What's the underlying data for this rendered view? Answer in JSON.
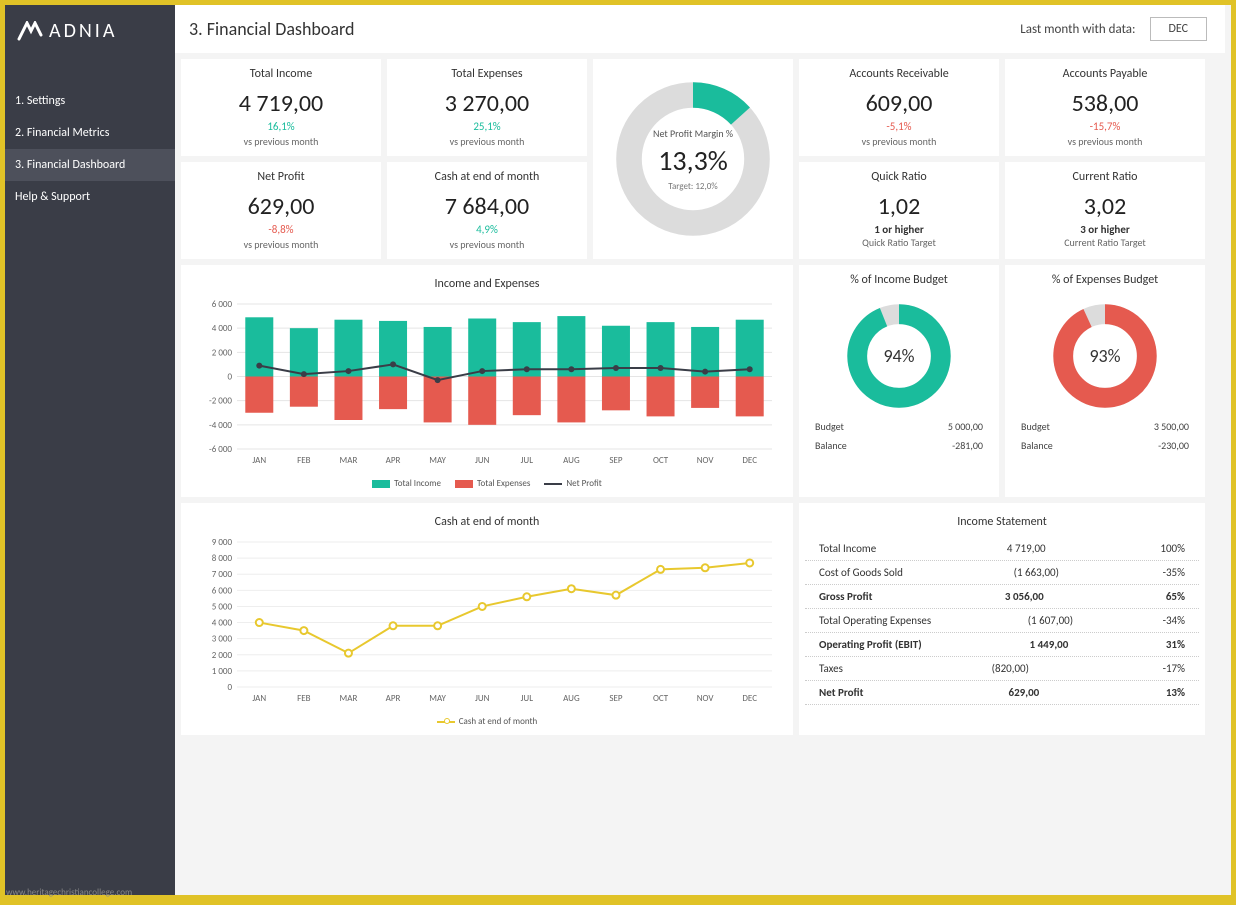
{
  "brand": "ADNIA",
  "page_title": "3. Financial Dashboard",
  "header_label": "Last month with data:",
  "month": "DEC",
  "nav": [
    "1. Settings",
    "2. Financial Metrics",
    "3. Financial Dashboard",
    "Help & Support"
  ],
  "cards": {
    "total_income": {
      "label": "Total Income",
      "value": "4 719,00",
      "pct": "16,1%",
      "sub": "vs previous month"
    },
    "total_expenses": {
      "label": "Total Expenses",
      "value": "3 270,00",
      "pct": "25,1%",
      "sub": "vs previous month"
    },
    "ar": {
      "label": "Accounts Receivable",
      "value": "609,00",
      "pct": "-5,1%",
      "sub": "vs previous month"
    },
    "ap": {
      "label": "Accounts Payable",
      "value": "538,00",
      "pct": "-15,7%",
      "sub": "vs previous month"
    },
    "net_profit": {
      "label": "Net Profit",
      "value": "629,00",
      "pct": "-8,8%",
      "sub": "vs previous month"
    },
    "cash": {
      "label": "Cash at end of month",
      "value": "7 684,00",
      "pct": "4,9%",
      "sub": "vs previous month"
    },
    "quick": {
      "label": "Quick Ratio",
      "value": "1,02",
      "sub1": "1 or higher",
      "sub2": "Quick Ratio Target"
    },
    "current": {
      "label": "Current Ratio",
      "value": "3,02",
      "sub1": "3 or higher",
      "sub2": "Current Ratio Target"
    }
  },
  "npm": {
    "label": "Net Profit Margin %",
    "value": "13,3%",
    "target": "Target:  12,0%"
  },
  "chart1": {
    "title": "Income and Expenses",
    "legend": [
      "Total Income",
      "Total Expenses",
      "Net Profit"
    ]
  },
  "inc_budget": {
    "title": "% of Income Budget",
    "value": "94%",
    "budget_l": "Budget",
    "budget_v": "5 000,00",
    "bal_l": "Balance",
    "bal_v": "-281,00"
  },
  "exp_budget": {
    "title": "% of Expenses Budget",
    "value": "93%",
    "budget_l": "Budget",
    "budget_v": "3 500,00",
    "bal_l": "Balance",
    "bal_v": "-230,00"
  },
  "chart2": {
    "title": "Cash at end of month",
    "legend": "Cash at end of month"
  },
  "is": {
    "title": "Income Statement",
    "rows": [
      {
        "l": "Total Income",
        "v": "4 719,00",
        "p": "100%",
        "b": false
      },
      {
        "l": "Cost of Goods Sold",
        "v": "(1 663,00)",
        "p": "-35%",
        "b": false
      },
      {
        "l": "Gross Profit",
        "v": "3 056,00",
        "p": "65%",
        "b": true
      },
      {
        "l": "Total Operating Expenses",
        "v": "(1 607,00)",
        "p": "-34%",
        "b": false
      },
      {
        "l": "Operating Profit (EBIT)",
        "v": "1 449,00",
        "p": "31%",
        "b": true
      },
      {
        "l": "Taxes",
        "v": "(820,00)",
        "p": "-17%",
        "b": false
      },
      {
        "l": "Net Profit",
        "v": "629,00",
        "p": "13%",
        "b": true
      }
    ]
  },
  "watermark": "www.heritagechristiancollege.com",
  "chart_data": [
    {
      "type": "bar",
      "title": "Income and Expenses",
      "categories": [
        "JAN",
        "FEB",
        "MAR",
        "APR",
        "MAY",
        "JUN",
        "JUL",
        "AUG",
        "SEP",
        "OCT",
        "NOV",
        "DEC"
      ],
      "series": [
        {
          "name": "Total Income",
          "values": [
            4900,
            4000,
            4700,
            4600,
            4100,
            4800,
            4500,
            5000,
            4200,
            4500,
            4100,
            4700
          ]
        },
        {
          "name": "Total Expenses",
          "values": [
            -3000,
            -2500,
            -3600,
            -2700,
            -3800,
            -4000,
            -3200,
            -3800,
            -2800,
            -3300,
            -2600,
            -3300
          ]
        },
        {
          "name": "Net Profit",
          "values": [
            900,
            200,
            450,
            1000,
            -300,
            450,
            600,
            600,
            700,
            700,
            400,
            600
          ]
        }
      ],
      "ylim": [
        -6000,
        6000
      ],
      "ylabel": "",
      "xlabel": ""
    },
    {
      "type": "line",
      "title": "Cash at end of month",
      "categories": [
        "JAN",
        "FEB",
        "MAR",
        "APR",
        "MAY",
        "JUN",
        "JUL",
        "AUG",
        "SEP",
        "OCT",
        "NOV",
        "DEC"
      ],
      "series": [
        {
          "name": "Cash at end of month",
          "values": [
            4000,
            3500,
            2100,
            3800,
            3800,
            5000,
            5600,
            6100,
            5700,
            7300,
            7400,
            7700
          ]
        }
      ],
      "ylim": [
        0,
        9000
      ],
      "ylabel": "",
      "xlabel": ""
    },
    {
      "type": "pie",
      "title": "Net Profit Margin %",
      "values": [
        13.3,
        86.7
      ]
    },
    {
      "type": "pie",
      "title": "% of Income Budget",
      "values": [
        94,
        6
      ]
    },
    {
      "type": "pie",
      "title": "% of Expenses Budget",
      "values": [
        93,
        7
      ]
    }
  ]
}
